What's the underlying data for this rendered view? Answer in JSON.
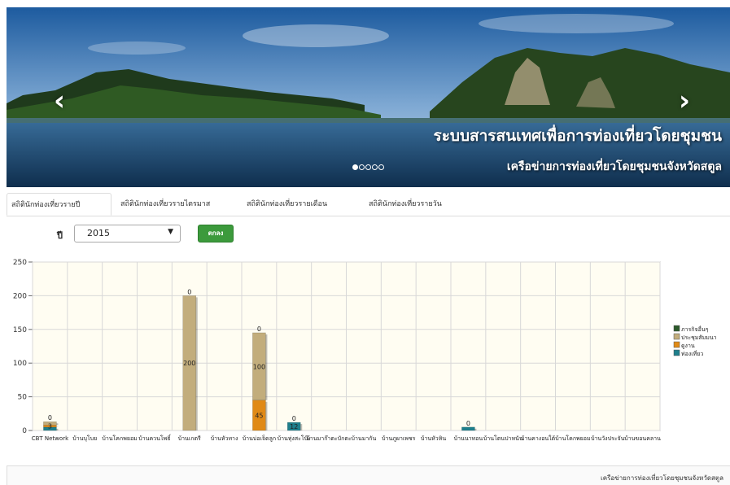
{
  "banner": {
    "title": "ระบบสารสนเทศเพื่อการท่องเที่ยวโดยชุมชน",
    "subtitle": "เครือข่ายการท่องเที่ยวโดยชุมชนจังหวัดสตูล",
    "prev_icon": "chevron-left-icon",
    "next_icon": "chevron-right-icon",
    "slides_total": 5,
    "active_slide": 1
  },
  "tabs": [
    {
      "label": "สถิตินักท่องเที่ยวรายปี",
      "active": true
    },
    {
      "label": "สถิตินักท่องเที่ยวรายไตรมาส",
      "active": false
    },
    {
      "label": "สถิตินักท่องเที่ยวรายเดือน",
      "active": false
    },
    {
      "label": "สถิตินักท่องเที่ยวรายวัน",
      "active": false
    }
  ],
  "filter": {
    "year_label": "ปี",
    "year_value": "2015",
    "submit_label": "ตกลง"
  },
  "chart_data": {
    "type": "bar",
    "stacked": true,
    "ylim": [
      0,
      250
    ],
    "yticks": [
      0,
      50,
      100,
      150,
      200,
      250
    ],
    "grid": true,
    "legend_position": "right",
    "categories": [
      "CBT Network",
      "บ้านบุโบย",
      "บ้านโคกพยอม",
      "บ้านควนโพธิ์",
      "บ้านเกตรี",
      "บ้านหัวทาง",
      "บ้านบ่อเจ็ดลูก",
      "บ้านทุ่งสะโบ๊ะ",
      "บ้านมาก๊าตะบักตะ",
      "บ้านมากัน",
      "บ้านภูผาเพชร",
      "บ้านหัวหิน",
      "บ้านนาทอน",
      "บ้านโตนปาหนัน",
      "บ้านคางอนใต้",
      "บ้านโคกพยอม",
      "บ้านวังประจัน",
      "บ้านขอนคลาน"
    ],
    "series": [
      {
        "name": "ท่องเที่ยว",
        "color": "#1e7f8c",
        "values": [
          5,
          0,
          0,
          0,
          0,
          0,
          0,
          12,
          0,
          0,
          0,
          0,
          5,
          0,
          0,
          0,
          0,
          0
        ]
      },
      {
        "name": "ดูงาน",
        "color": "#e08a16",
        "values": [
          3,
          0,
          0,
          0,
          0,
          0,
          45,
          0,
          0,
          0,
          0,
          0,
          0,
          0,
          0,
          0,
          0,
          0
        ]
      },
      {
        "name": "ประชุมสัมมนา",
        "color": "#c2ad7c",
        "values": [
          5,
          0,
          0,
          0,
          200,
          0,
          100,
          0,
          0,
          0,
          0,
          0,
          0,
          0,
          0,
          0,
          0,
          0
        ]
      },
      {
        "name": "ภารกิจอื่นๆ",
        "color": "#2c5a2a",
        "values": [
          0,
          0,
          0,
          0,
          0,
          0,
          0,
          0,
          0,
          0,
          0,
          0,
          0,
          0,
          0,
          0,
          0,
          0
        ]
      }
    ],
    "data_labels": [
      {
        "category": "CBT Network",
        "labels": [
          "0",
          "3"
        ]
      },
      {
        "category": "บ้านเกตรี",
        "labels": [
          "200",
          "0"
        ]
      },
      {
        "category": "บ้านบ่อเจ็ดลูก",
        "labels": [
          "45",
          "100",
          "0"
        ]
      },
      {
        "category": "บ้านทุ่งสะโบ๊ะ",
        "labels": [
          "12",
          "0"
        ]
      },
      {
        "category": "บ้านนาทอน",
        "labels": [
          "0"
        ]
      }
    ]
  },
  "footer": {
    "text": "เครือข่ายการท่องเที่ยวโดยชุมชนจังหวัดสตูล"
  }
}
